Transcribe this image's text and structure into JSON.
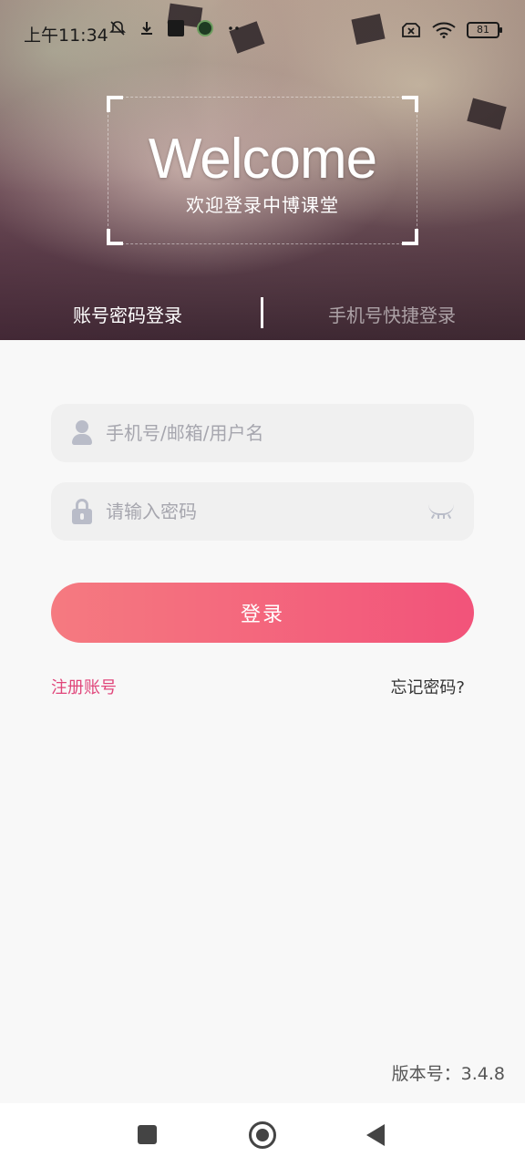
{
  "status_bar": {
    "time": "上午11:34",
    "battery": "81",
    "icons_left": [
      "mute-icon",
      "download-icon",
      "app-icon",
      "app-icon-2",
      "more-icon"
    ],
    "icons_right": [
      "no-sim-icon",
      "wifi-icon",
      "battery-icon"
    ]
  },
  "hero": {
    "title": "Welcome",
    "subtitle": "欢迎登录中博课堂"
  },
  "tabs": [
    {
      "label": "账号密码登录",
      "active": true
    },
    {
      "label": "手机号快捷登录",
      "active": false
    }
  ],
  "form": {
    "username_placeholder": "手机号/邮箱/用户名",
    "password_placeholder": "请输入密码",
    "login_label": "登录",
    "register_label": "注册账号",
    "forgot_label": "忘记密码?"
  },
  "footer": {
    "version": "版本号：3.4.8"
  },
  "colors": {
    "accent": "#f2537a",
    "accent_start": "#f57a80",
    "link": "#e0457a"
  }
}
